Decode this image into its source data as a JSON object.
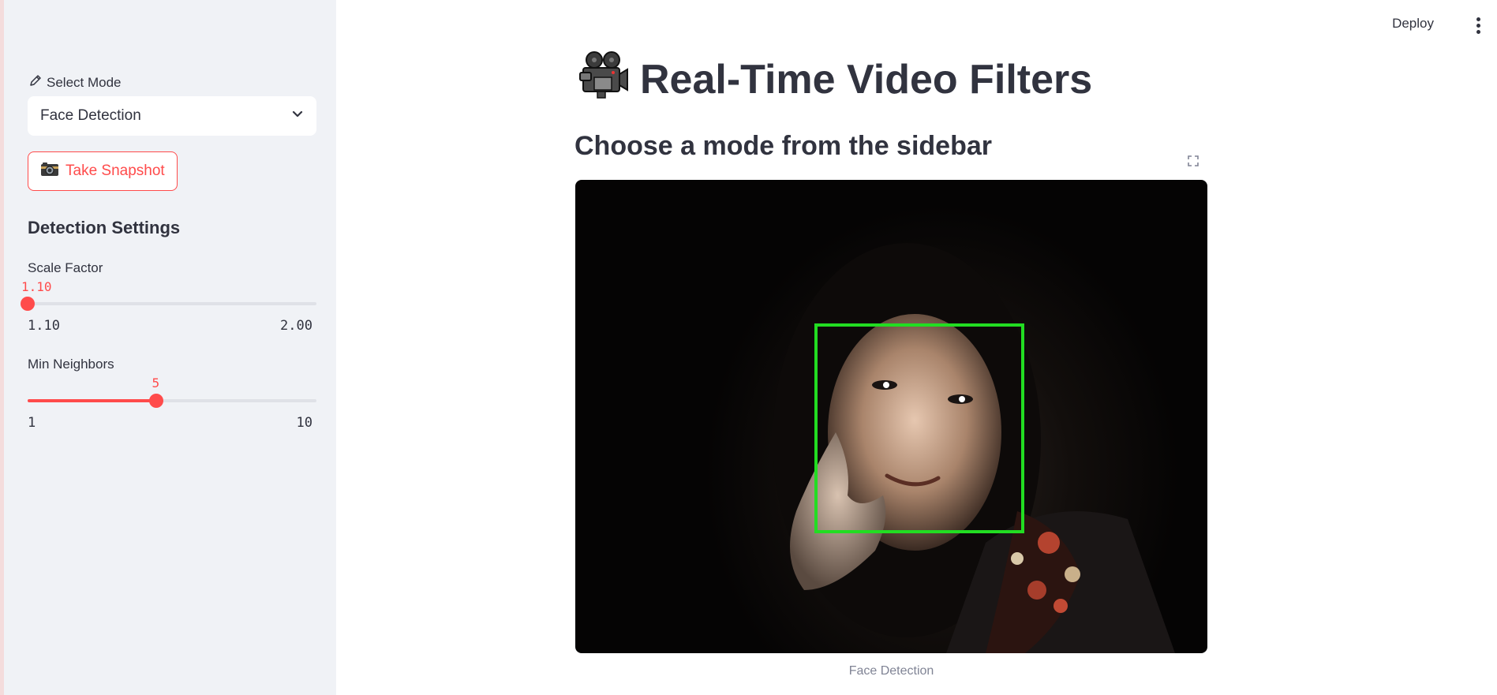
{
  "header": {
    "deploy_label": "Deploy",
    "menu_icon": "vertical-dots-icon"
  },
  "sidebar": {
    "mode_label": "Select Mode",
    "mode_icon": "pencil-icon",
    "mode_selected": "Face Detection",
    "snapshot_icon": "camera-icon",
    "snapshot_label": "Take Snapshot",
    "settings_heading": "Detection Settings",
    "scale_factor": {
      "label": "Scale Factor",
      "value": "1.10",
      "min": "1.10",
      "max": "2.00",
      "fraction": 0.0
    },
    "min_neighbors": {
      "label": "Min Neighbors",
      "value": "5",
      "min": "1",
      "max": "10",
      "fraction": 0.444
    }
  },
  "main": {
    "title_icon": "movie-camera-icon",
    "title": "Real-Time Video Filters",
    "subtitle": "Choose a mode from the sidebar",
    "video_caption": "Face Detection"
  },
  "colors": {
    "accent": "#ff4b4b",
    "sidebar_bg": "#f0f2f6",
    "text": "#31333f",
    "detection_box": "#22dd22"
  }
}
